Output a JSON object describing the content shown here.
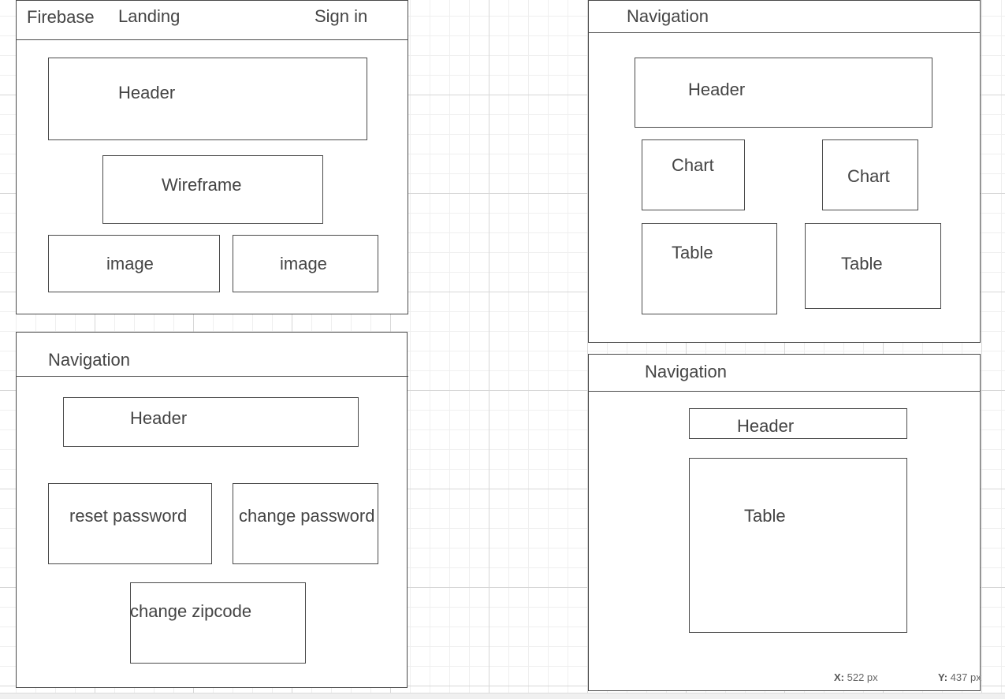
{
  "colors": {
    "stroke": "#4a4a4a",
    "text": "#444444",
    "grid_minor": "#efefef",
    "grid_major": "#d7d7d7"
  },
  "landing": {
    "brand": "Firebase",
    "landing_link": "Landing",
    "sign_in": "Sign in",
    "header": "Header",
    "wireframe": "Wireframe",
    "image_1": "image",
    "image_2": "image"
  },
  "account": {
    "navigation": "Navigation",
    "header": "Header",
    "reset_password": "reset password",
    "change_password": "change password",
    "change_zipcode": "change zipcode"
  },
  "dashboard": {
    "navigation": "Navigation",
    "header": "Header",
    "chart_1": "Chart",
    "chart_2": "Chart",
    "table_1": "Table",
    "table_2": "Table"
  },
  "table_page": {
    "navigation": "Navigation",
    "header": "Header",
    "table": "Table"
  },
  "status": {
    "x_label": "X:",
    "x_value": "522 px",
    "y_label": "Y:",
    "y_value": "437 px"
  }
}
